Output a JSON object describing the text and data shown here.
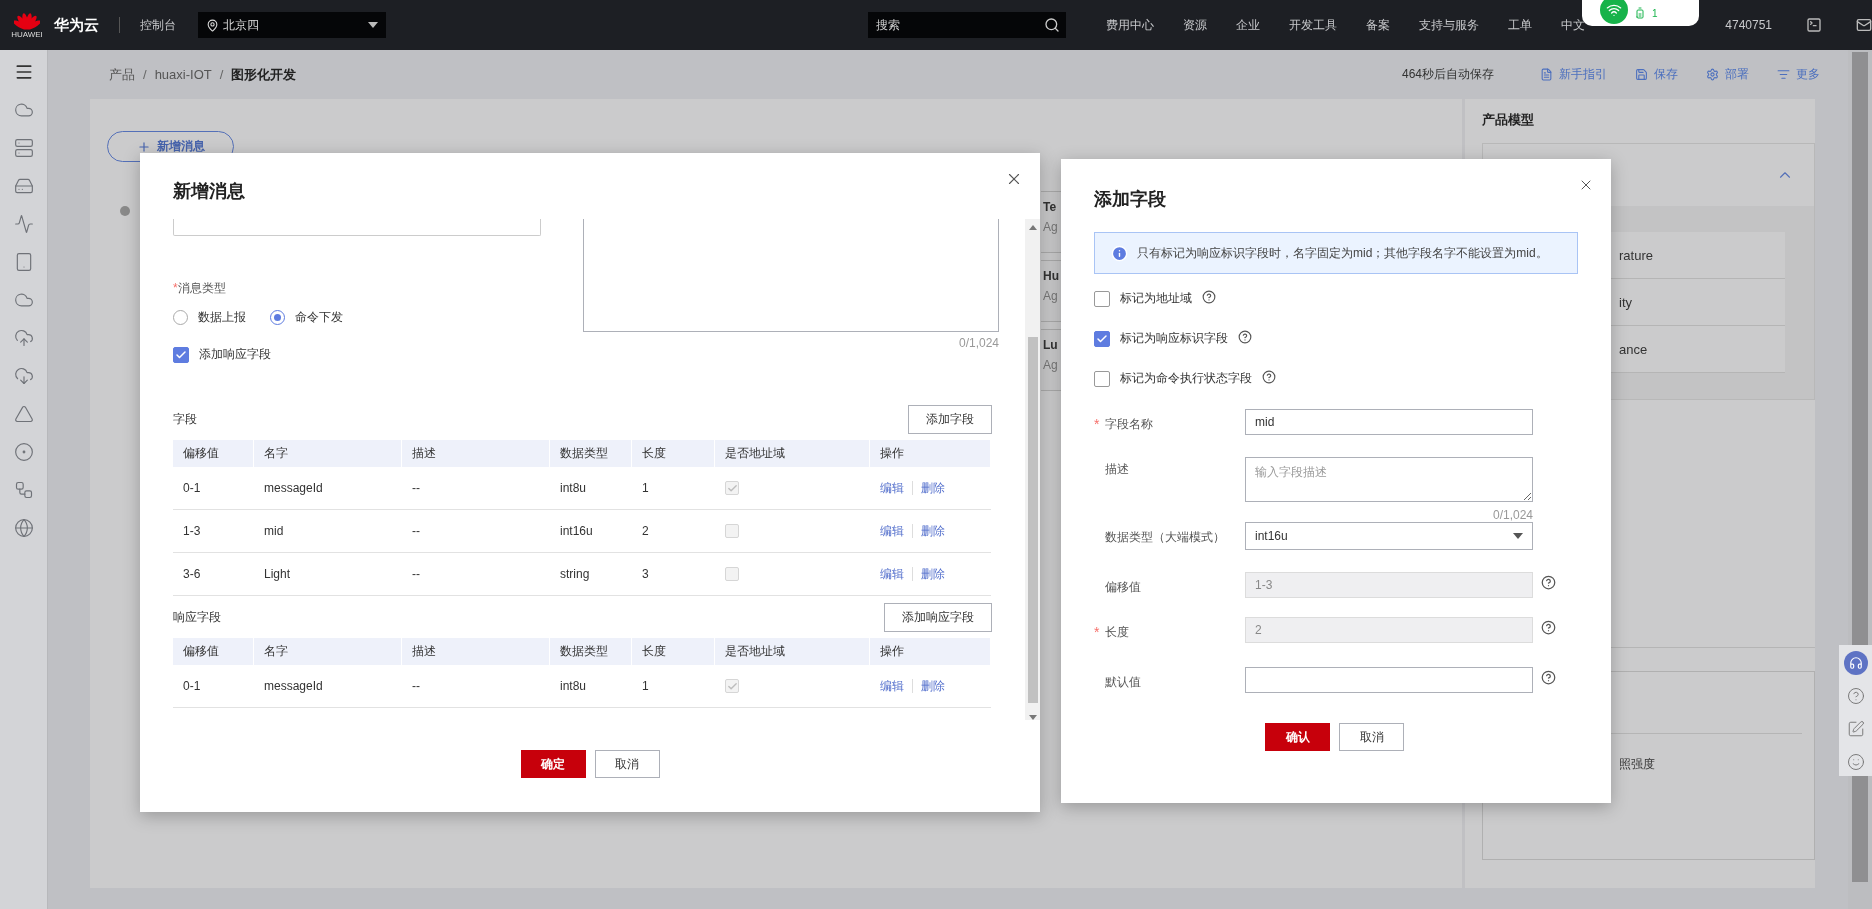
{
  "top_bar": {
    "logo_text": "HUAWEI",
    "brand": "华为云",
    "console": "控制台",
    "region": "北京四",
    "search_placeholder": "搜索",
    "menu": [
      "费用中心",
      "资源",
      "企业",
      "开发工具",
      "备案",
      "支持与服务",
      "工单"
    ],
    "language": "中文",
    "account": "4740751",
    "network_popup": {
      "text": "1"
    }
  },
  "breadcrumb": {
    "items": [
      "产品",
      "huaxi-IOT",
      "图形化开发"
    ],
    "separators": [
      "/",
      "/"
    ]
  },
  "toolbar": {
    "autosave": "464秒后自动保存",
    "actions": [
      "新手指引",
      "保存",
      "部署",
      "更多"
    ]
  },
  "canvas": {
    "add_button": "新增消息",
    "cards": [
      {
        "title": "Te",
        "subtitle": "Ag"
      },
      {
        "title": "Hu",
        "subtitle": "Ag"
      },
      {
        "title": "Lu",
        "subtitle": "Ag"
      }
    ]
  },
  "product_model": {
    "title": "产品模型",
    "expanded": true,
    "properties": [
      "rature",
      "ity",
      "ance"
    ],
    "lower_text": "照强度"
  },
  "message_dialog": {
    "title": "新增消息",
    "counter": "0/1,024",
    "type_label": "消息类型",
    "type_required_mark": "*",
    "radios": [
      {
        "label": "数据上报",
        "selected": false
      },
      {
        "label": "命令下发",
        "selected": true
      }
    ],
    "response_checkbox": {
      "label": "添加响应字段",
      "checked": true
    },
    "sections": [
      {
        "title": "字段",
        "add_button": "添加字段",
        "columns": [
          "偏移值",
          "名字",
          "描述",
          "数据类型",
          "长度",
          "是否地址域",
          "操作"
        ],
        "rows": [
          {
            "offset": "0-1",
            "name": "messageId",
            "description": "--",
            "type": "int8u",
            "length": "1",
            "is_address": true,
            "disabled": true,
            "actions": [
              "编辑",
              "删除"
            ]
          },
          {
            "offset": "1-3",
            "name": "mid",
            "description": "--",
            "type": "int16u",
            "length": "2",
            "is_address": false,
            "disabled": true,
            "actions": [
              "编辑",
              "删除"
            ]
          },
          {
            "offset": "3-6",
            "name": "Light",
            "description": "--",
            "type": "string",
            "length": "3",
            "is_address": false,
            "disabled": true,
            "actions": [
              "编辑",
              "删除"
            ]
          }
        ]
      },
      {
        "title": "响应字段",
        "add_button": "添加响应字段",
        "columns": [
          "偏移值",
          "名字",
          "描述",
          "数据类型",
          "长度",
          "是否地址域",
          "操作"
        ],
        "rows": [
          {
            "offset": "0-1",
            "name": "messageId",
            "description": "--",
            "type": "int8u",
            "length": "1",
            "is_address": true,
            "disabled": true,
            "actions": [
              "编辑",
              "删除"
            ]
          }
        ]
      }
    ],
    "buttons": {
      "ok": "确定",
      "cancel": "取消"
    }
  },
  "field_dialog": {
    "title": "添加字段",
    "info": "只有标记为响应标识字段时，名字固定为mid；其他字段名字不能设置为mid。",
    "checkboxes": [
      {
        "label": "标记为地址域",
        "checked": false
      },
      {
        "label": "标记为响应标识字段",
        "checked": true
      },
      {
        "label": "标记为命令执行状态字段",
        "checked": false
      }
    ],
    "fields": [
      {
        "kind": "input",
        "required_mark": "*",
        "label": "字段名称",
        "value": "mid",
        "disabled": false,
        "help": false
      },
      {
        "kind": "textarea",
        "label": "描述",
        "placeholder": "输入字段描述",
        "counter": "0/1,024",
        "disabled": false,
        "help": false
      },
      {
        "kind": "select",
        "label": "数据类型（大端模式）",
        "value": "int16u",
        "disabled": false,
        "help": false
      },
      {
        "kind": "input",
        "label": "偏移值",
        "value": "1-3",
        "disabled": true,
        "help": true
      },
      {
        "kind": "input",
        "required_mark": "*",
        "label": "长度",
        "value": "2",
        "disabled": true,
        "help": true
      },
      {
        "kind": "input",
        "label": "默认值",
        "disabled": false,
        "help": true
      }
    ],
    "buttons": {
      "ok": "确认",
      "cancel": "取消"
    }
  }
}
